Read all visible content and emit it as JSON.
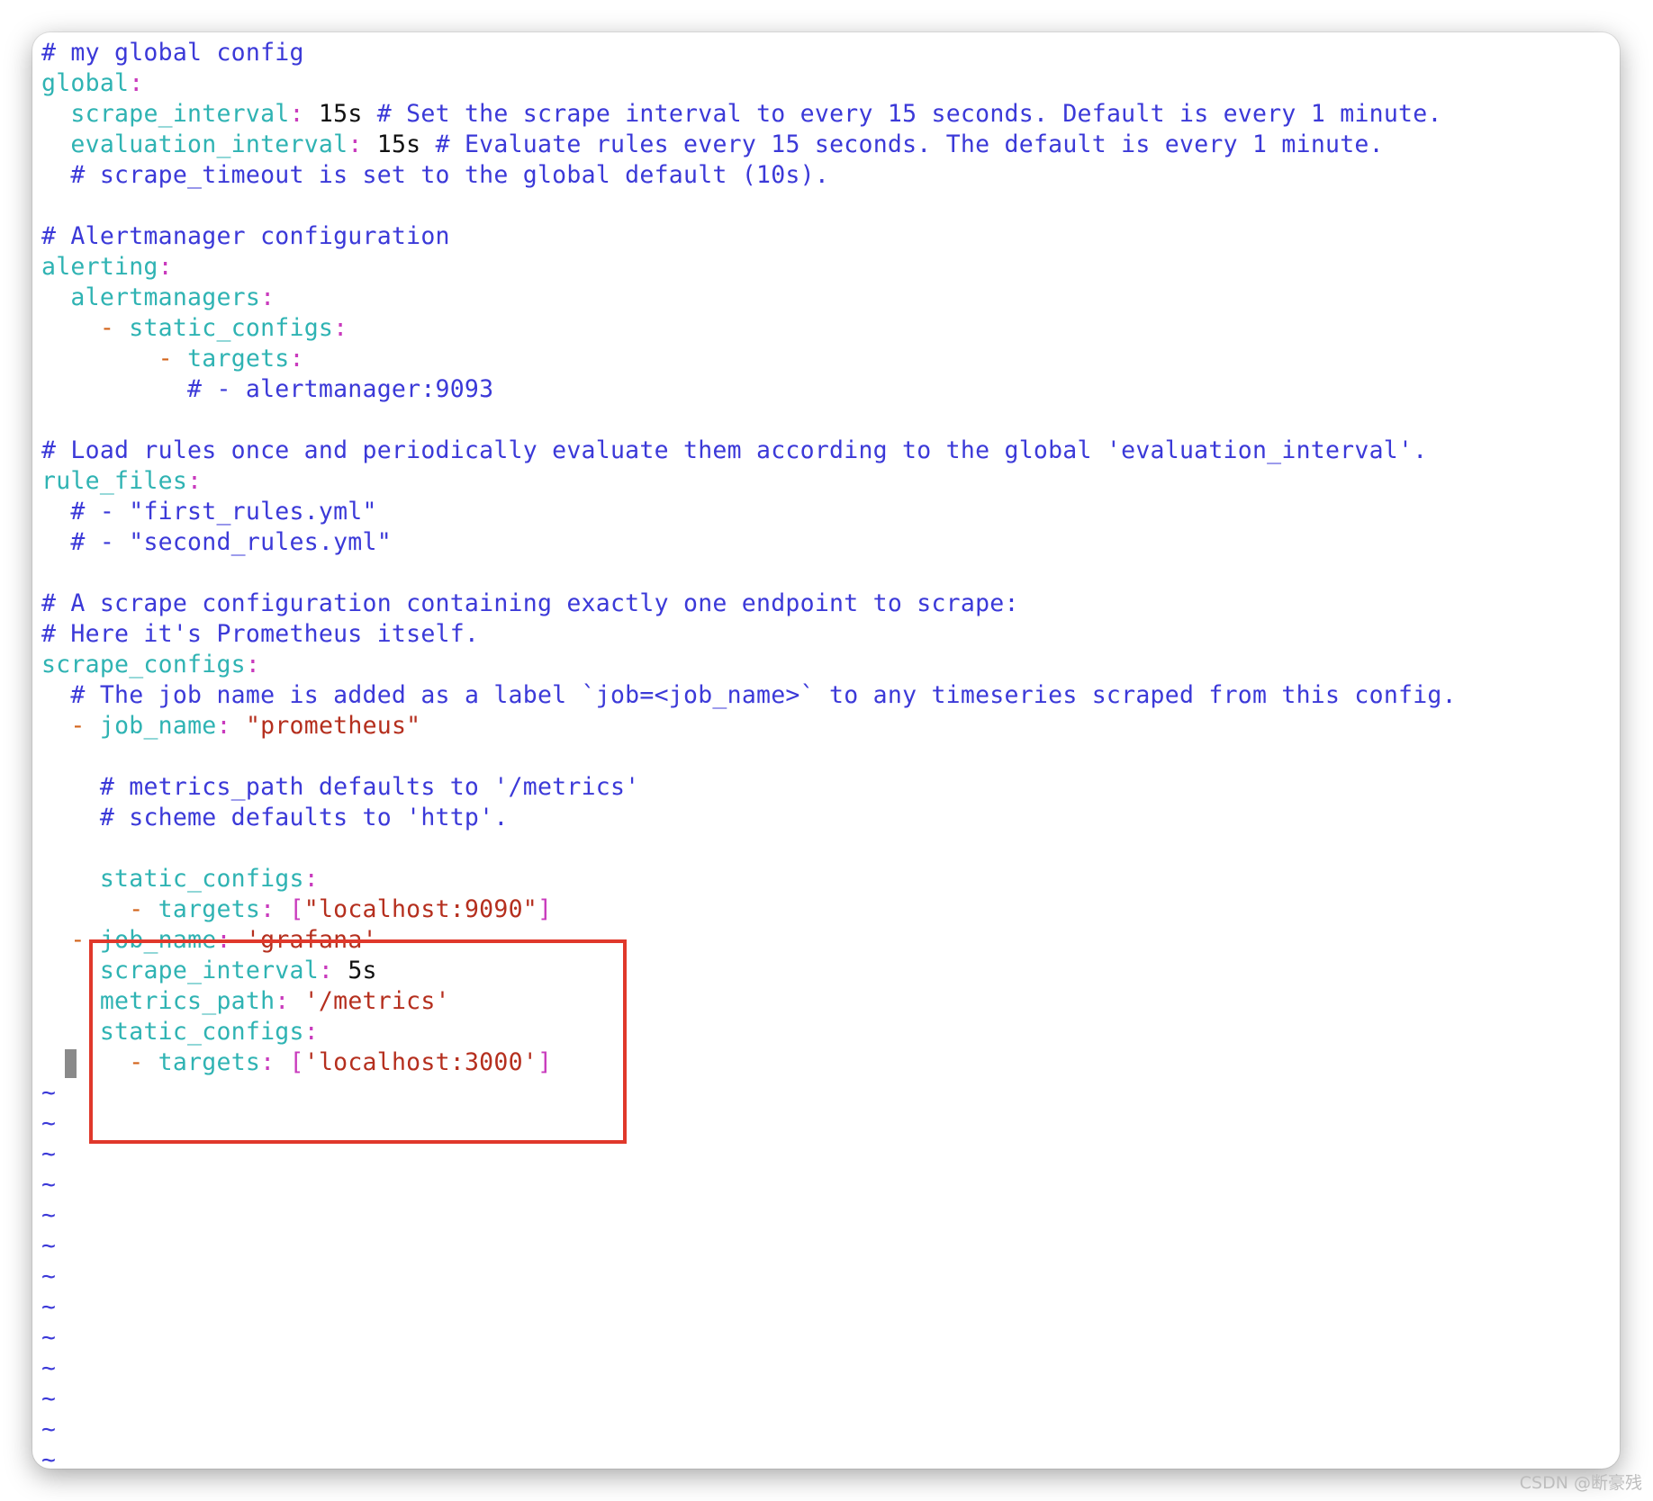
{
  "editor": {
    "lines": [
      {
        "segments": [
          {
            "c": "comment",
            "t": "# my global config"
          }
        ]
      },
      {
        "segments": [
          {
            "c": "key",
            "t": "global"
          },
          {
            "c": "punct",
            "t": ":"
          }
        ]
      },
      {
        "segments": [
          {
            "c": "plain",
            "t": "  "
          },
          {
            "c": "key",
            "t": "scrape_interval"
          },
          {
            "c": "punct",
            "t": ":"
          },
          {
            "c": "plain",
            "t": " 15s "
          },
          {
            "c": "comment",
            "t": "# Set the scrape interval to every 15 seconds. Default is every 1 minute."
          }
        ]
      },
      {
        "segments": [
          {
            "c": "plain",
            "t": "  "
          },
          {
            "c": "key",
            "t": "evaluation_interval"
          },
          {
            "c": "punct",
            "t": ":"
          },
          {
            "c": "plain",
            "t": " 15s "
          },
          {
            "c": "comment",
            "t": "# Evaluate rules every 15 seconds. The default is every 1 minute."
          }
        ]
      },
      {
        "segments": [
          {
            "c": "plain",
            "t": "  "
          },
          {
            "c": "comment",
            "t": "# scrape_timeout is set to the global default (10s)."
          }
        ]
      },
      {
        "segments": []
      },
      {
        "segments": [
          {
            "c": "comment",
            "t": "# Alertmanager configuration"
          }
        ]
      },
      {
        "segments": [
          {
            "c": "key",
            "t": "alerting"
          },
          {
            "c": "punct",
            "t": ":"
          }
        ]
      },
      {
        "segments": [
          {
            "c": "plain",
            "t": "  "
          },
          {
            "c": "key",
            "t": "alertmanagers"
          },
          {
            "c": "punct",
            "t": ":"
          }
        ]
      },
      {
        "segments": [
          {
            "c": "plain",
            "t": "    "
          },
          {
            "c": "dash",
            "t": "-"
          },
          {
            "c": "plain",
            "t": " "
          },
          {
            "c": "key",
            "t": "static_configs"
          },
          {
            "c": "punct",
            "t": ":"
          }
        ]
      },
      {
        "segments": [
          {
            "c": "plain",
            "t": "        "
          },
          {
            "c": "dash",
            "t": "-"
          },
          {
            "c": "plain",
            "t": " "
          },
          {
            "c": "key",
            "t": "targets"
          },
          {
            "c": "punct",
            "t": ":"
          }
        ]
      },
      {
        "segments": [
          {
            "c": "plain",
            "t": "          "
          },
          {
            "c": "comment",
            "t": "# - alertmanager:9093"
          }
        ]
      },
      {
        "segments": []
      },
      {
        "segments": [
          {
            "c": "comment",
            "t": "# Load rules once and periodically evaluate them according to the global 'evaluation_interval'."
          }
        ]
      },
      {
        "segments": [
          {
            "c": "key",
            "t": "rule_files"
          },
          {
            "c": "punct",
            "t": ":"
          }
        ]
      },
      {
        "segments": [
          {
            "c": "plain",
            "t": "  "
          },
          {
            "c": "comment",
            "t": "# - \"first_rules.yml\""
          }
        ]
      },
      {
        "segments": [
          {
            "c": "plain",
            "t": "  "
          },
          {
            "c": "comment",
            "t": "# - \"second_rules.yml\""
          }
        ]
      },
      {
        "segments": []
      },
      {
        "segments": [
          {
            "c": "comment",
            "t": "# A scrape configuration containing exactly one endpoint to scrape:"
          }
        ]
      },
      {
        "segments": [
          {
            "c": "comment",
            "t": "# Here it's Prometheus itself."
          }
        ]
      },
      {
        "segments": [
          {
            "c": "key",
            "t": "scrape_configs"
          },
          {
            "c": "punct",
            "t": ":"
          }
        ]
      },
      {
        "segments": [
          {
            "c": "plain",
            "t": "  "
          },
          {
            "c": "comment",
            "t": "# The job name is added as a label `job=<job_name>` to any timeseries scraped from this config."
          }
        ]
      },
      {
        "segments": [
          {
            "c": "plain",
            "t": "  "
          },
          {
            "c": "dash",
            "t": "-"
          },
          {
            "c": "plain",
            "t": " "
          },
          {
            "c": "key",
            "t": "job_name"
          },
          {
            "c": "punct",
            "t": ":"
          },
          {
            "c": "plain",
            "t": " "
          },
          {
            "c": "str",
            "t": "\"prometheus\""
          }
        ]
      },
      {
        "segments": []
      },
      {
        "segments": [
          {
            "c": "plain",
            "t": "    "
          },
          {
            "c": "comment",
            "t": "# metrics_path defaults to '/metrics'"
          }
        ]
      },
      {
        "segments": [
          {
            "c": "plain",
            "t": "    "
          },
          {
            "c": "comment",
            "t": "# scheme defaults to 'http'."
          }
        ]
      },
      {
        "segments": []
      },
      {
        "segments": [
          {
            "c": "plain",
            "t": "    "
          },
          {
            "c": "key",
            "t": "static_configs"
          },
          {
            "c": "punct",
            "t": ":"
          }
        ]
      },
      {
        "segments": [
          {
            "c": "plain",
            "t": "      "
          },
          {
            "c": "dash",
            "t": "-"
          },
          {
            "c": "plain",
            "t": " "
          },
          {
            "c": "key",
            "t": "targets"
          },
          {
            "c": "punct",
            "t": ": ["
          },
          {
            "c": "str",
            "t": "\"localhost:9090\""
          },
          {
            "c": "punct",
            "t": "]"
          }
        ]
      },
      {
        "segments": [
          {
            "c": "plain",
            "t": "  "
          },
          {
            "c": "dash",
            "t": "-"
          },
          {
            "c": "plain",
            "t": " "
          },
          {
            "c": "key",
            "t": "job_name"
          },
          {
            "c": "punct",
            "t": ":"
          },
          {
            "c": "plain",
            "t": " "
          },
          {
            "c": "str",
            "t": "'grafana'"
          }
        ]
      },
      {
        "segments": [
          {
            "c": "plain",
            "t": "    "
          },
          {
            "c": "key",
            "t": "scrape_interval"
          },
          {
            "c": "punct",
            "t": ":"
          },
          {
            "c": "plain",
            "t": " 5s"
          }
        ]
      },
      {
        "segments": [
          {
            "c": "plain",
            "t": "    "
          },
          {
            "c": "key",
            "t": "metrics_path"
          },
          {
            "c": "punct",
            "t": ":"
          },
          {
            "c": "plain",
            "t": " "
          },
          {
            "c": "str",
            "t": "'/metrics'"
          }
        ]
      },
      {
        "segments": [
          {
            "c": "plain",
            "t": "    "
          },
          {
            "c": "key",
            "t": "static_configs"
          },
          {
            "c": "punct",
            "t": ":"
          }
        ]
      },
      {
        "segments": [
          {
            "c": "plain",
            "t": "      "
          },
          {
            "c": "dash",
            "t": "-"
          },
          {
            "c": "plain",
            "t": " "
          },
          {
            "c": "key",
            "t": "targets"
          },
          {
            "c": "punct",
            "t": ": ["
          },
          {
            "c": "str",
            "t": "'localhost:3000'"
          },
          {
            "c": "punct",
            "t": "]"
          }
        ],
        "cursor": true
      },
      {
        "segments": [
          {
            "c": "tilde",
            "t": "~"
          }
        ]
      },
      {
        "segments": [
          {
            "c": "tilde",
            "t": "~"
          }
        ]
      },
      {
        "segments": [
          {
            "c": "tilde",
            "t": "~"
          }
        ]
      },
      {
        "segments": [
          {
            "c": "tilde",
            "t": "~"
          }
        ]
      },
      {
        "segments": [
          {
            "c": "tilde",
            "t": "~"
          }
        ]
      },
      {
        "segments": [
          {
            "c": "tilde",
            "t": "~"
          }
        ]
      },
      {
        "segments": [
          {
            "c": "tilde",
            "t": "~"
          }
        ]
      },
      {
        "segments": [
          {
            "c": "tilde",
            "t": "~"
          }
        ]
      },
      {
        "segments": [
          {
            "c": "tilde",
            "t": "~"
          }
        ]
      },
      {
        "segments": [
          {
            "c": "tilde",
            "t": "~"
          }
        ]
      },
      {
        "segments": [
          {
            "c": "tilde",
            "t": "~"
          }
        ]
      },
      {
        "segments": [
          {
            "c": "tilde",
            "t": "~"
          }
        ]
      },
      {
        "segments": [
          {
            "c": "tilde",
            "t": "~"
          }
        ]
      }
    ]
  },
  "colors": {
    "comment": "#3b39d8",
    "key": "#2fb3b3",
    "punct": "#c93bbd",
    "dash": "#d3641b",
    "string": "#b52f1e",
    "highlight_box": "#e0382b"
  },
  "watermark": "CSDN @断豪残"
}
